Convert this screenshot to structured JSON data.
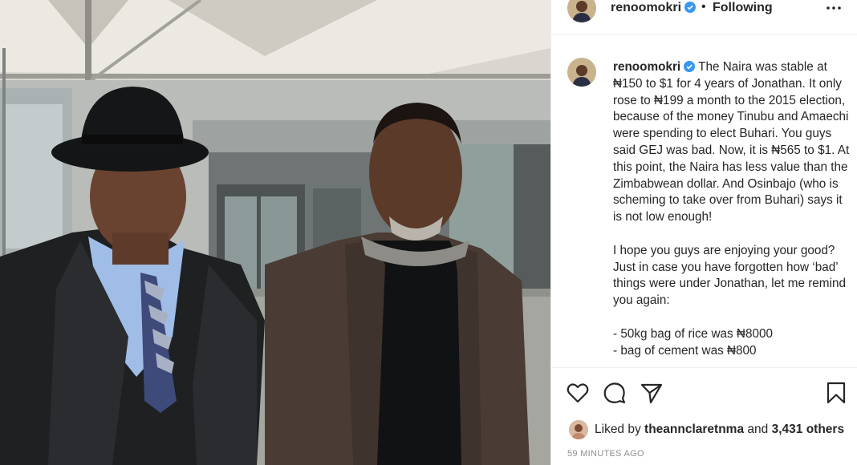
{
  "post": {
    "username": "renoomokri",
    "verified": true,
    "separator": "•",
    "follow_status": "Following",
    "caption_text": " The Naira was stable at ₦150 to $1 for 4 years of Jonathan. It only rose to ₦199 a month to the 2015 election, because of the money Tinubu and Amaechi were spending to elect Buhari. You guys said GEJ was bad. Now, it is ₦565 to $1. At this point, the Naira has less value than the Zimbabwean dollar. And Osinbajo (who is scheming to take over from Buhari) says it is not low enough!\n\nI hope you guys are enjoying your good? Just in case you have forgotten how ‘bad’ things were under Jonathan, let me remind you again:\n\n- 50kg bag of rice was ₦8000\n- bag of cement was ₦800",
    "likes": {
      "prefix": "Liked by",
      "liker": "theannclaretnma",
      "connector": "and",
      "others": "3,431 others"
    },
    "timestamp": "59 minutes ago"
  },
  "icons": {
    "verified": "verified-badge-icon",
    "more": "more-options-icon",
    "like": "heart-icon",
    "comment": "comment-icon",
    "share": "paper-plane-icon",
    "save": "bookmark-icon"
  },
  "colors": {
    "verified_blue": "#3897f0",
    "text": "#262626",
    "muted": "#8e8e8e",
    "divider": "#efefef"
  }
}
